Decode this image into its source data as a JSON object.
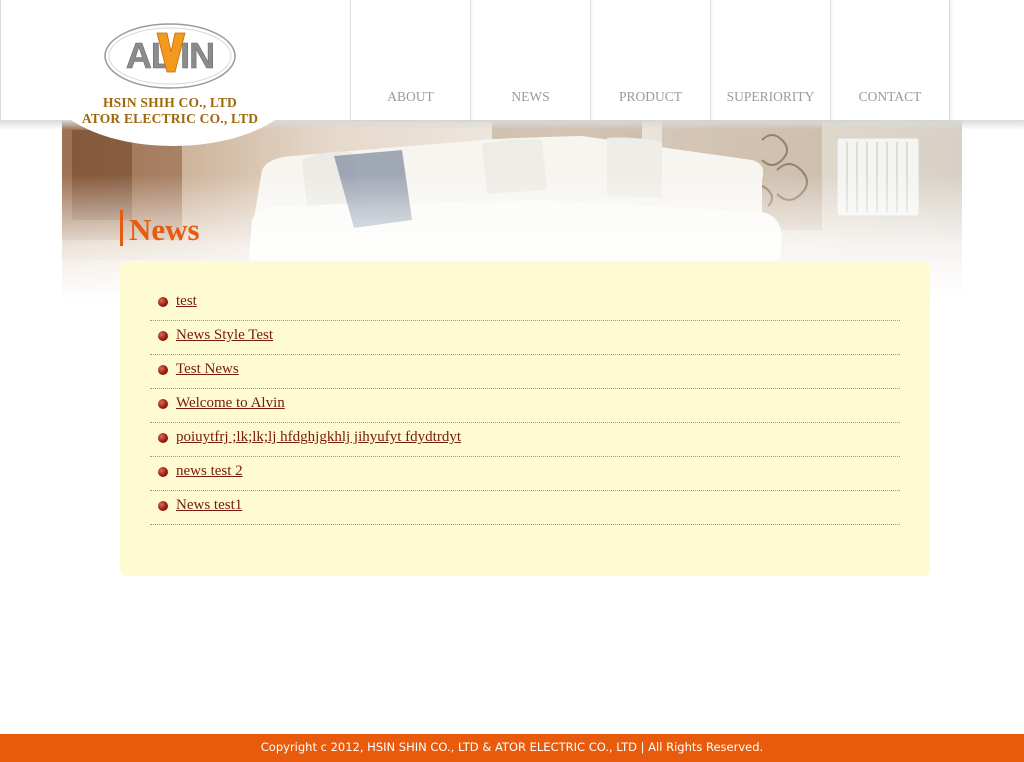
{
  "brand": {
    "logo_text": "ALVIN",
    "company_line_1": "HSIN SHIH CO., LTD",
    "company_line_2": "ATOR ELECTRIC CO., LTD",
    "accent_color": "#e55b10",
    "company_color": "#a0660a"
  },
  "nav": {
    "items": [
      {
        "label": "ABOUT"
      },
      {
        "label": "NEWS"
      },
      {
        "label": "PRODUCT"
      },
      {
        "label": "SUPERIORITY"
      },
      {
        "label": "CONTACT"
      }
    ]
  },
  "page": {
    "title": "News"
  },
  "news": {
    "items": [
      {
        "title": "test"
      },
      {
        "title": "News Style Test"
      },
      {
        "title": "Test News"
      },
      {
        "title": "Welcome to Alvin"
      },
      {
        "title": "poiuytfrj ;lk;lk;lj hfdghjgkhlj jihyufyt fdydtrdyt"
      },
      {
        "title": "news test 2"
      },
      {
        "title": "News test1"
      }
    ],
    "panel_color": "#fefbd2",
    "bullet_icon": "red-ball-bullet-icon"
  },
  "footer": {
    "copyright": "Copyright c 2012, HSIN SHIN CO., LTD & ATOR ELECTRIC CO., LTD | All Rights Reserved.",
    "background_color": "#e85a0c"
  }
}
